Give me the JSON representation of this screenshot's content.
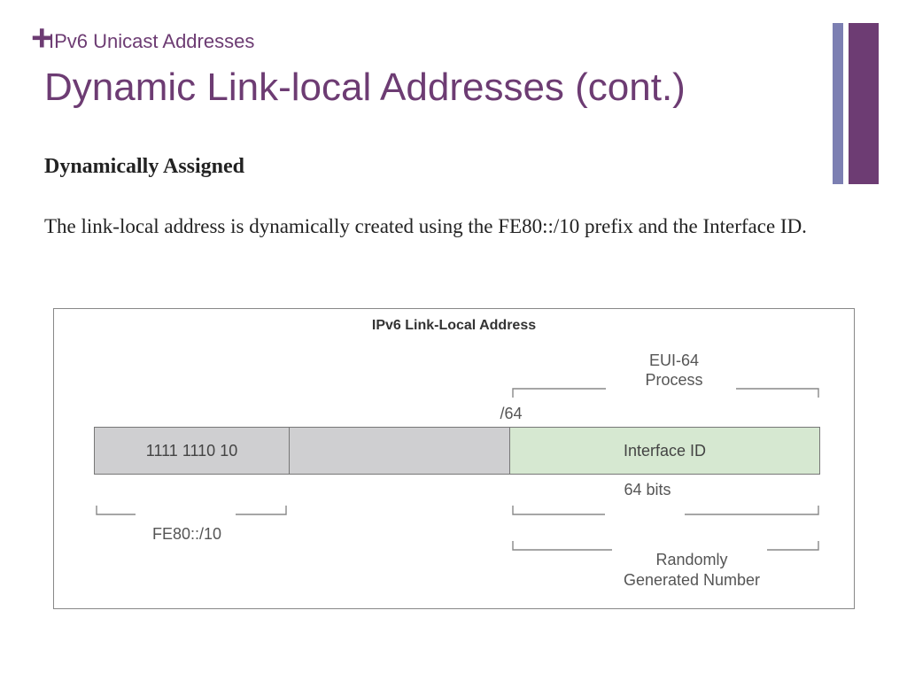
{
  "header": {
    "plus": "+",
    "topic": "IPv6 Unicast Addresses",
    "title": "Dynamic Link-local Addresses (cont.)"
  },
  "content": {
    "subhead": "Dynamically Assigned",
    "paragraph": "The link-local address is dynamically created using the FE80::/10 prefix and the Interface ID."
  },
  "diagram": {
    "title": "IPv6 Link-Local Address",
    "cells": {
      "prefix_bits": "1111 1110 10",
      "middle": "",
      "interface": "Interface ID"
    },
    "labels": {
      "slash64": "/64",
      "eui": "EUI-64 Process",
      "bits64": "64 bits",
      "fe80": "FE80::/10",
      "random": "Randomly Generated Number"
    }
  },
  "colors": {
    "accent_purple": "#6d3c73",
    "accent_blue": "#7c7fb2",
    "cell_gray": "#cfcfd1",
    "cell_green": "#d6e8d1"
  }
}
